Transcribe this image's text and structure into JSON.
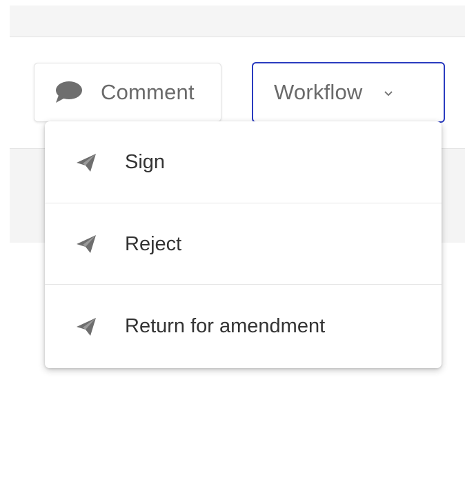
{
  "toolbar": {
    "comment_label": "Comment",
    "workflow_label": "Workflow"
  },
  "workflow_menu": {
    "items": [
      {
        "label": "Sign",
        "icon": "send-icon"
      },
      {
        "label": "Reject",
        "icon": "send-icon"
      },
      {
        "label": "Return for amendment",
        "icon": "send-icon"
      }
    ]
  },
  "colors": {
    "focus_border": "#2a3bbf",
    "icon_gray": "#6e6e6e",
    "menu_text": "#333333"
  }
}
